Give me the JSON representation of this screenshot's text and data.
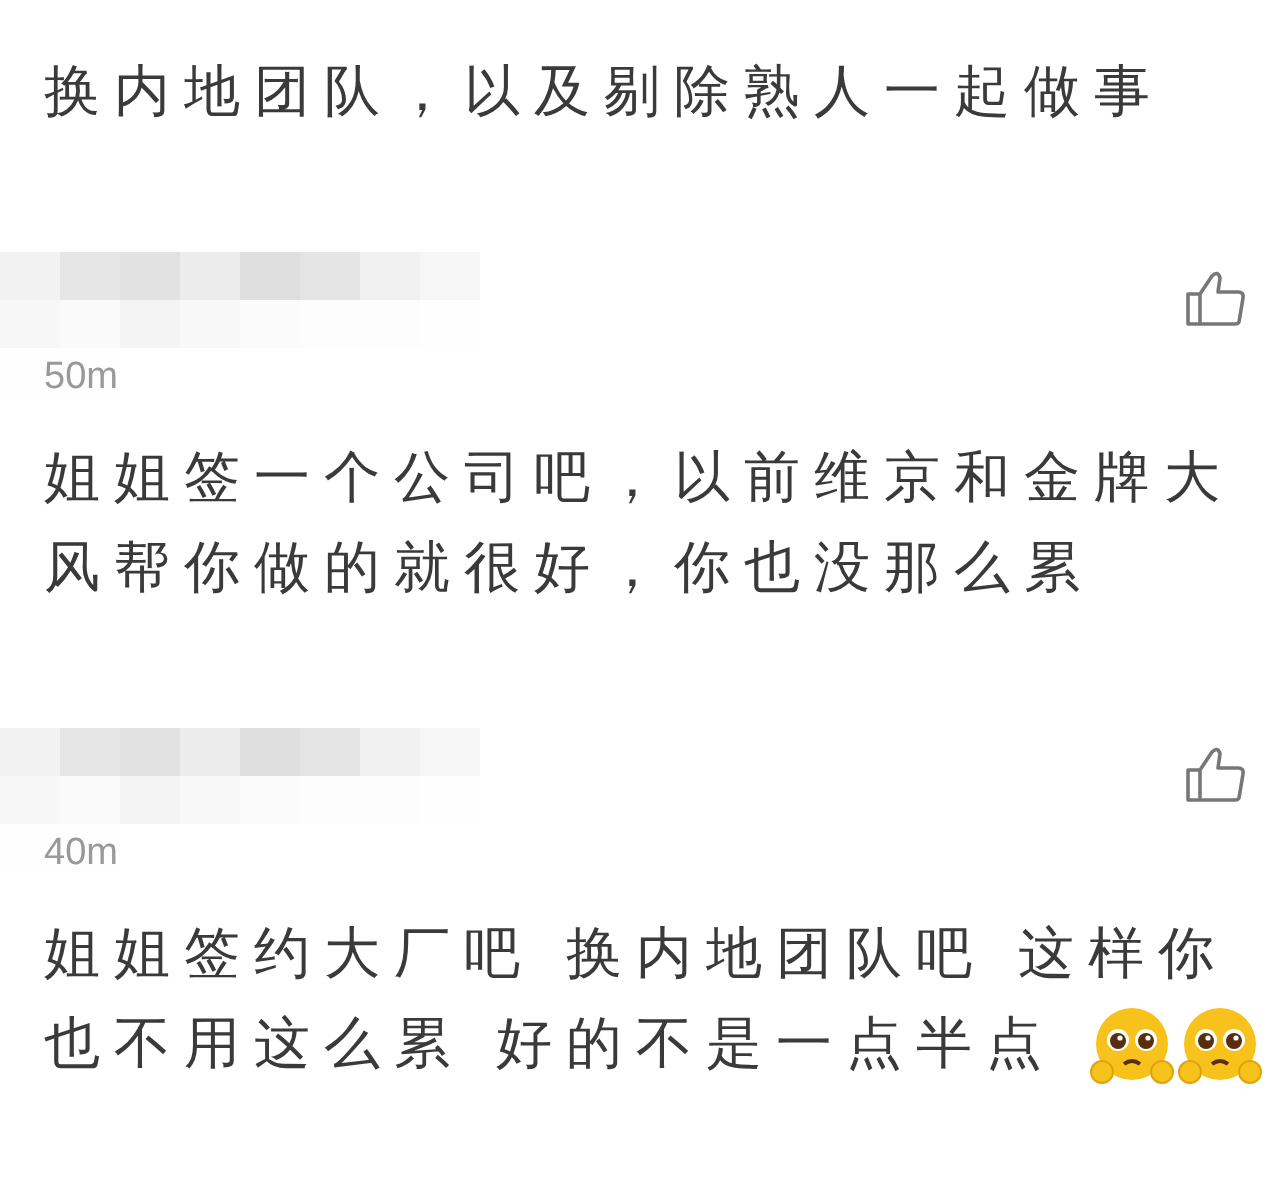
{
  "comments": [
    {
      "kind": "continuation",
      "text": "换内地团队，以及剔除熟人一起做事"
    },
    {
      "kind": "full",
      "time": "50m",
      "text": "姐姐签一个公司吧，以前维京和金牌大风帮你做的就很好，你也没那么累"
    },
    {
      "kind": "full",
      "time": "40m",
      "text": "姐姐签约大厂吧 换内地团队吧 这样你也不用这么累 好的不是一点半点",
      "emojis": [
        {
          "kind": "pleading"
        },
        {
          "kind": "pleading"
        }
      ]
    }
  ]
}
